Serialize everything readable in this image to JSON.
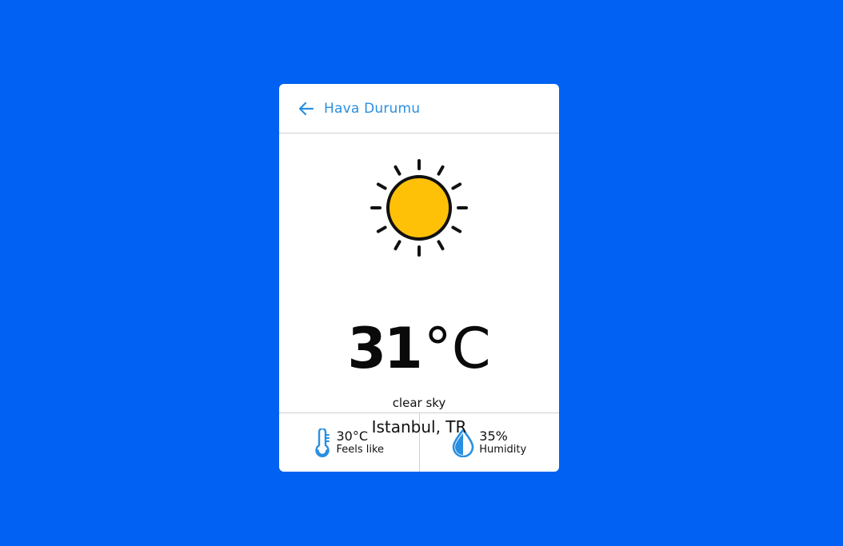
{
  "header": {
    "title": "Hava Durumu",
    "back_icon": "arrow-left-icon",
    "accent_color": "#2a8fe0"
  },
  "weather": {
    "icon": "sun-icon",
    "temperature_value": "31",
    "temperature_unit": "°C",
    "description": "clear sky",
    "location": "Istanbul, TR"
  },
  "stats": [
    {
      "icon": "thermometer-icon",
      "value": "30°C",
      "label": "Feels like"
    },
    {
      "icon": "water-drop-icon",
      "value": "35%",
      "label": "Humidity"
    }
  ],
  "colors": {
    "background": "#0061f2",
    "card": "#ffffff",
    "sun_fill": "#ffc107",
    "icon_blue": "#2a8fe0"
  }
}
